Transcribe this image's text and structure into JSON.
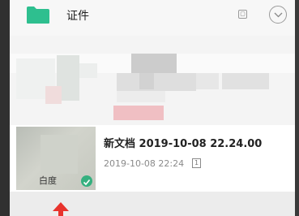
{
  "folder": {
    "title": "证件",
    "icon": "folder-icon",
    "color": "#2ebf8f",
    "badge_glyph": "▢"
  },
  "file": {
    "name": "新文档 2019-10-08 22.24.00",
    "meta": "2019-10-08 22:24",
    "pages_badge": "1",
    "thumb_caption": "白度"
  },
  "annotation": {
    "arrow_color": "#e8332d"
  }
}
